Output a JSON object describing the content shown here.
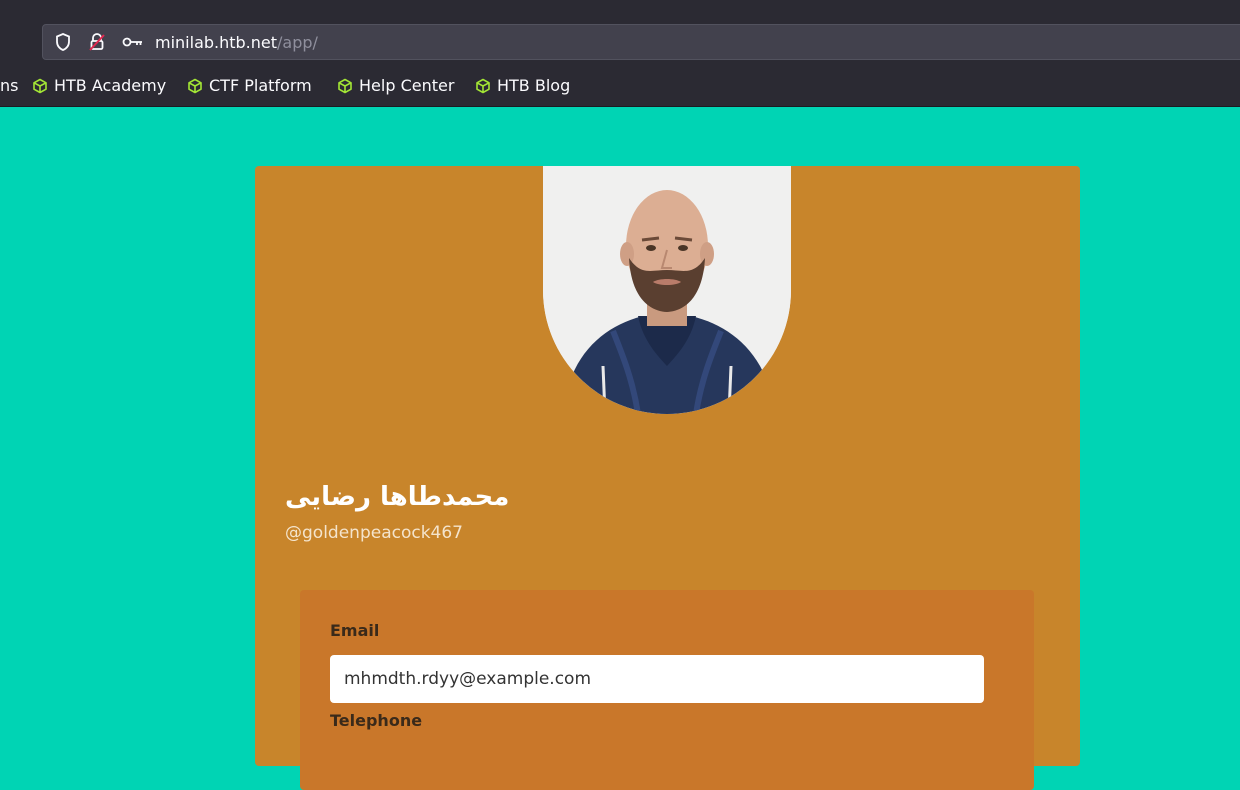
{
  "browser": {
    "url_host": "minilab.htb.net",
    "url_path": "/app/",
    "bookmarks_cut": "ns",
    "bookmarks": [
      "HTB Academy",
      "CTF Platform",
      "Help Center",
      "HTB Blog"
    ]
  },
  "profile": {
    "name": "محمدطاها رضایی",
    "handle": "@goldenpeacock467",
    "email_label": "Email",
    "email_value": "mhmdth.rdyy@example.com",
    "telephone_label": "Telephone"
  },
  "colors": {
    "page_background": "#00d4b4",
    "card": "#c8852b",
    "info_panel": "#c9772a",
    "bookmark_icon": "#a3e635"
  }
}
